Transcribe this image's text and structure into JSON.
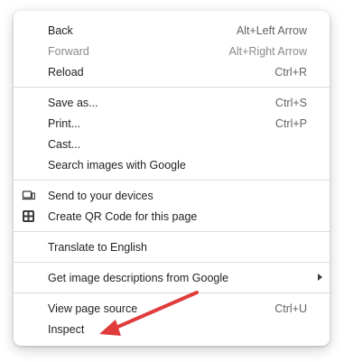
{
  "menu": {
    "group1": [
      {
        "label": "Back",
        "shortcut": "Alt+Left Arrow",
        "disabled": false
      },
      {
        "label": "Forward",
        "shortcut": "Alt+Right Arrow",
        "disabled": true
      },
      {
        "label": "Reload",
        "shortcut": "Ctrl+R",
        "disabled": false
      }
    ],
    "group2": [
      {
        "label": "Save as...",
        "shortcut": "Ctrl+S"
      },
      {
        "label": "Print...",
        "shortcut": "Ctrl+P"
      },
      {
        "label": "Cast...",
        "shortcut": ""
      },
      {
        "label": "Search images with Google",
        "shortcut": ""
      }
    ],
    "group3": [
      {
        "label": "Send to your devices",
        "icon": "send-to-devices-icon"
      },
      {
        "label": "Create QR Code for this page",
        "icon": "qr-code-icon"
      }
    ],
    "group4": [
      {
        "label": "Translate to English"
      }
    ],
    "group5": [
      {
        "label": "Get image descriptions from Google",
        "has_submenu": true
      }
    ],
    "group6": [
      {
        "label": "View page source",
        "shortcut": "Ctrl+U"
      },
      {
        "label": "Inspect",
        "shortcut": ""
      }
    ]
  },
  "annotation": {
    "arrow_color": "#e03c3c",
    "points_to": "Inspect"
  },
  "colors": {
    "text": "#1f1f1f",
    "disabled": "#8a8a8a",
    "shortcut": "#5f6368",
    "separator": "#dcdcdc"
  }
}
